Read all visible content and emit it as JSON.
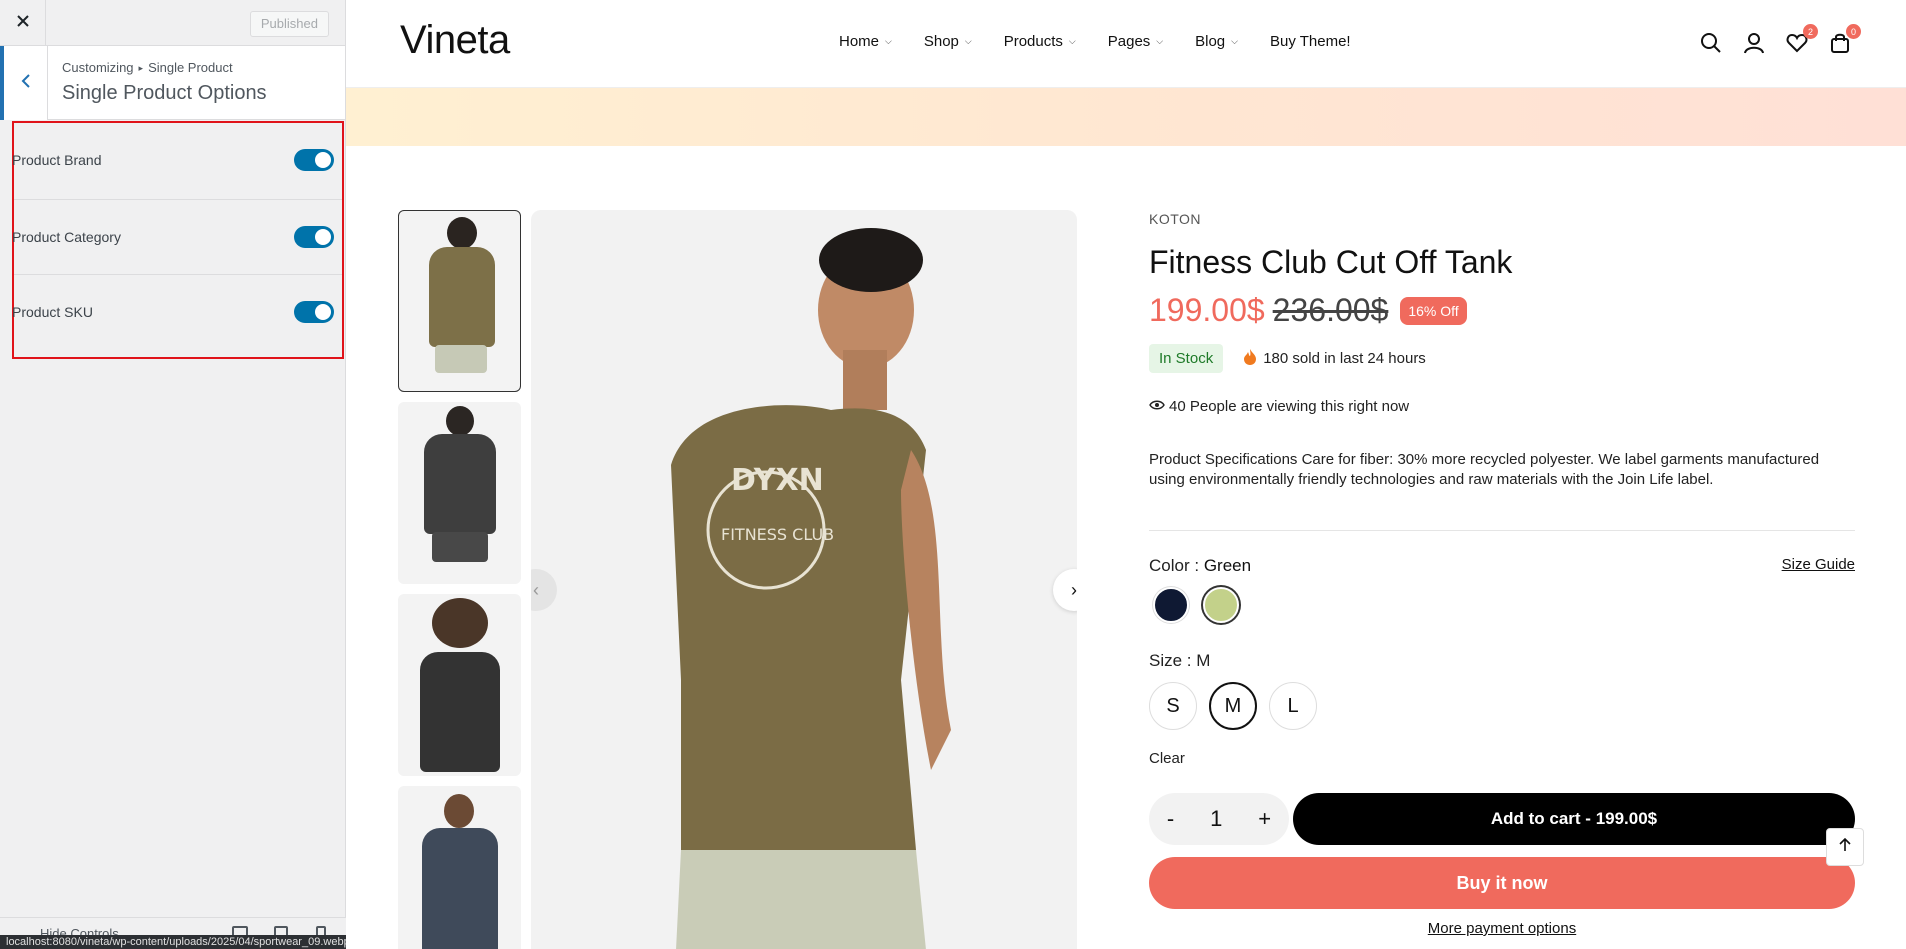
{
  "customizer": {
    "publish_label": "Published",
    "breadcrumb_root": "Customizing",
    "breadcrumb_section": "Single Product",
    "panel_title": "Single Product Options",
    "options": [
      {
        "label": "Product Brand",
        "enabled": true
      },
      {
        "label": "Product Category",
        "enabled": true
      },
      {
        "label": "Product SKU",
        "enabled": true
      }
    ],
    "hide_controls_label": "Hide Controls",
    "accent_color": "#0073aa",
    "highlight_color": "#e0131a"
  },
  "status_bar": {
    "url": "localhost:8080/vineta/wp-content/uploads/2025/04/sportwear_09.webp"
  },
  "site": {
    "logo": "Vineta",
    "nav": [
      {
        "label": "Home",
        "has_dropdown": true
      },
      {
        "label": "Shop",
        "has_dropdown": true
      },
      {
        "label": "Products",
        "has_dropdown": true
      },
      {
        "label": "Pages",
        "has_dropdown": true
      },
      {
        "label": "Blog",
        "has_dropdown": true
      },
      {
        "label": "Buy Theme!",
        "has_dropdown": false
      }
    ],
    "header_icons": [
      {
        "icon": "search-icon"
      },
      {
        "icon": "account-icon"
      },
      {
        "icon": "wishlist-icon",
        "badge": "2"
      },
      {
        "icon": "cart-icon",
        "badge": "0"
      }
    ],
    "brand_color": "#f06a5d"
  },
  "product": {
    "brand": "KOTON",
    "title": "Fitness Club Cut Off Tank",
    "price_now": "199.00$",
    "price_old": "236.00$",
    "discount": "16% Off",
    "stock": "In Stock",
    "sold_text": "180 sold in last 24 hours",
    "viewing_text": "40 People are viewing this right now",
    "description": "Product Specifications Care for fiber: 30% more recycled polyester. We label garments manufactured using environmentally friendly technologies and raw materials with the Join Life label.",
    "color_label": "Color :",
    "color_value": "Green",
    "size_guide": "Size Guide",
    "swatches": [
      {
        "name": "navy",
        "color": "#0f1933",
        "selected": false
      },
      {
        "name": "green",
        "color": "#c3d18a",
        "selected": true
      }
    ],
    "size_label": "Size :",
    "size_value": "M",
    "sizes": [
      {
        "label": "S",
        "selected": false
      },
      {
        "label": "M",
        "selected": true
      },
      {
        "label": "L",
        "selected": false
      }
    ],
    "clear": "Clear",
    "qty_minus": "-",
    "quantity": "1",
    "qty_plus": "+",
    "add_to_cart": "Add to cart - 199.00$",
    "buy_now": "Buy it now",
    "more_payment": "More payment options"
  }
}
